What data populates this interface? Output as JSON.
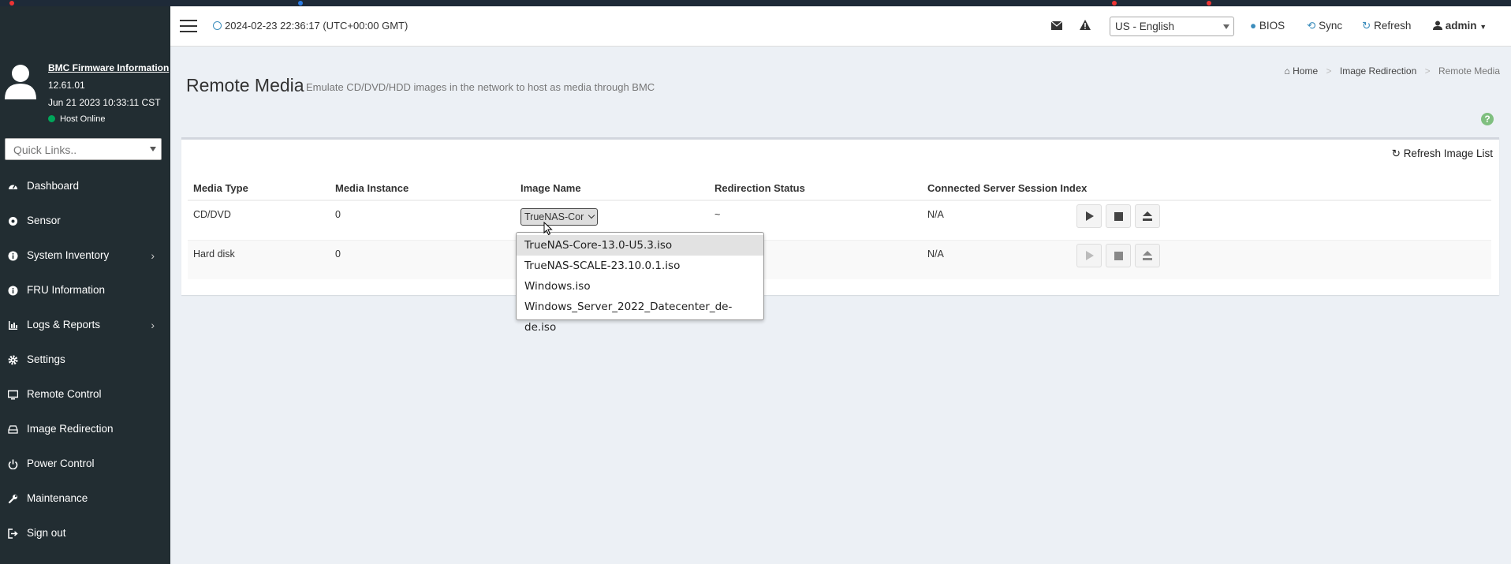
{
  "sidebar": {
    "firmware_title": "BMC Firmware Information",
    "firmware_version": "12.61.01",
    "firmware_date": "Jun 21 2023 10:33:11 CST",
    "host_status": "Host Online",
    "quick_links_placeholder": "Quick Links..",
    "items": [
      {
        "label": "Dashboard",
        "icon": "dashboard-icon",
        "has_children": false
      },
      {
        "label": "Sensor",
        "icon": "sensor-icon",
        "has_children": false
      },
      {
        "label": "System Inventory",
        "icon": "info-icon",
        "has_children": true
      },
      {
        "label": "FRU Information",
        "icon": "info-icon",
        "has_children": false
      },
      {
        "label": "Logs & Reports",
        "icon": "bar-chart-icon",
        "has_children": true
      },
      {
        "label": "Settings",
        "icon": "gear-icon",
        "has_children": false
      },
      {
        "label": "Remote Control",
        "icon": "monitor-icon",
        "has_children": false
      },
      {
        "label": "Image Redirection",
        "icon": "hdd-icon",
        "has_children": false
      },
      {
        "label": "Power Control",
        "icon": "power-icon",
        "has_children": false
      },
      {
        "label": "Maintenance",
        "icon": "wrench-icon",
        "has_children": false
      },
      {
        "label": "Sign out",
        "icon": "sign-out-icon",
        "has_children": false
      }
    ]
  },
  "header": {
    "datetime": "2024-02-23 22:36:17 (UTC+00:00 GMT)",
    "language": "US - English",
    "bios_label": "BIOS",
    "sync_label": "Sync",
    "refresh_label": "Refresh",
    "user_label": "admin"
  },
  "page": {
    "title": "Remote Media",
    "subtitle": "Emulate CD/DVD/HDD images in the network to host as media through BMC",
    "breadcrumb": {
      "home": "Home",
      "parent": "Image Redirection",
      "current": "Remote Media"
    },
    "refresh_image_list": "Refresh Image List"
  },
  "table": {
    "headers": [
      "Media Type",
      "Media Instance",
      "Image Name",
      "Redirection Status",
      "Connected Server Session Index"
    ],
    "rows": [
      {
        "media_type": "CD/DVD",
        "instance": "0",
        "image_selected": "TrueNAS-Cor",
        "status": "~",
        "session": "N/A"
      },
      {
        "media_type": "Hard disk",
        "instance": "0",
        "image_selected": "",
        "status": "",
        "session": "N/A"
      }
    ]
  },
  "dropdown_options": [
    "TrueNAS-Core-13.0-U5.3.iso",
    "TrueNAS-SCALE-23.10.0.1.iso",
    "Windows.iso",
    "Windows_Server_2022_Datecenter_de-de.iso"
  ],
  "colors": {
    "sidebar_bg": "#222d32",
    "content_bg": "#ecf0f5",
    "accent": "#3c8dbc",
    "online_green": "#00a65a"
  }
}
